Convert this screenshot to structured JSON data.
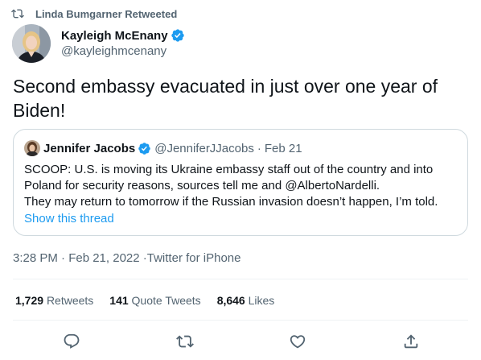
{
  "retweet_context": {
    "icon": "retweet-icon",
    "text": "Linda Bumgarner Retweeted"
  },
  "tweet": {
    "author_name": "Kayleigh McEnany",
    "author_handle": "@kayleighmcenany",
    "text": "Second embassy evacuated in just over one year of Biden!",
    "timestamp": "3:28 PM · Feb 21, 2022 · ",
    "source": "Twitter for iPhone"
  },
  "quote": {
    "author_name": "Jennifer Jacobs",
    "author_handle": "@JenniferJJacobs",
    "separator": "·",
    "date": "Feb 21",
    "lines": [
      "SCOOP: U.S. is moving its Ukraine embassy staff out of the country and into",
      "Poland for security reasons, sources tell me and @AlbertoNardelli.",
      "They may return to tomorrow if the Russian invasion doesn’t happen, I’m told."
    ],
    "show_thread": "Show this thread"
  },
  "stats": {
    "retweets_count": "1,729",
    "retweets_label": "Retweets",
    "quotes_count": "141",
    "quotes_label": "Quote Tweets",
    "likes_count": "8,646",
    "likes_label": "Likes"
  },
  "actions": [
    "reply-icon",
    "retweet-icon",
    "like-icon",
    "share-icon"
  ],
  "colors": {
    "accent": "#1d9bf0",
    "secondary_text": "#536471",
    "border": "#cfd9de"
  }
}
